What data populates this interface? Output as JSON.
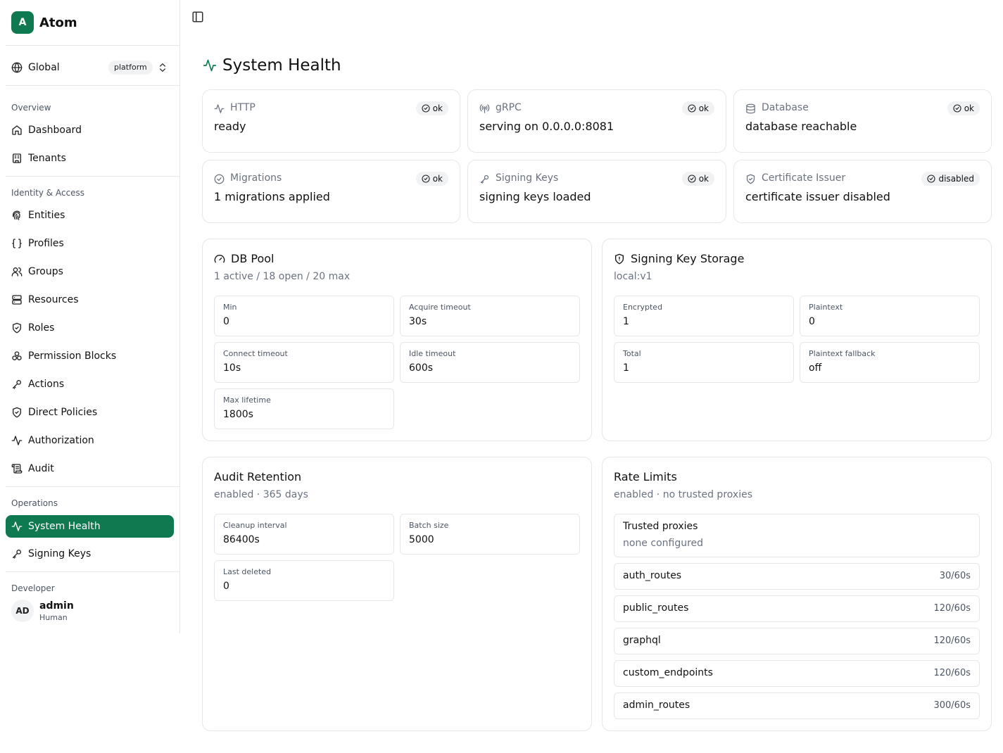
{
  "brand": {
    "logo_letter": "A",
    "name": "Atom"
  },
  "scope": {
    "label": "Global",
    "badge": "platform"
  },
  "sidebar": {
    "sections": [
      {
        "label": "Overview",
        "items": [
          {
            "label": "Dashboard",
            "icon": "home-icon"
          },
          {
            "label": "Tenants",
            "icon": "building-icon"
          }
        ]
      },
      {
        "label": "Identity & Access",
        "items": [
          {
            "label": "Entities",
            "icon": "fingerprint-icon"
          },
          {
            "label": "Profiles",
            "icon": "braces-icon"
          },
          {
            "label": "Groups",
            "icon": "users-icon"
          },
          {
            "label": "Resources",
            "icon": "server-icon"
          },
          {
            "label": "Roles",
            "icon": "shield-check-icon"
          },
          {
            "label": "Permission Blocks",
            "icon": "blocks-icon"
          },
          {
            "label": "Actions",
            "icon": "key-icon"
          },
          {
            "label": "Direct Policies",
            "icon": "shield-check-icon"
          },
          {
            "label": "Authorization",
            "icon": "activity-icon"
          },
          {
            "label": "Audit",
            "icon": "scroll-icon"
          }
        ]
      },
      {
        "label": "Operations",
        "items": [
          {
            "label": "System Health",
            "icon": "activity-icon",
            "active": true
          },
          {
            "label": "Signing Keys",
            "icon": "key-icon"
          }
        ]
      },
      {
        "label": "Developer",
        "items": []
      }
    ]
  },
  "user": {
    "initials": "AD",
    "name": "admin",
    "type": "Human"
  },
  "page": {
    "title": "System Health"
  },
  "status_cards": [
    {
      "title": "HTTP",
      "value": "ready",
      "badge": "ok",
      "icon": "activity-icon"
    },
    {
      "title": "gRPC",
      "value": "serving on 0.0.0.0:8081",
      "badge": "ok",
      "icon": "radio-icon"
    },
    {
      "title": "Database",
      "value": "database reachable",
      "badge": "ok",
      "icon": "database-icon"
    },
    {
      "title": "Migrations",
      "value": "1 migrations applied",
      "badge": "ok",
      "icon": "check-circle-icon"
    },
    {
      "title": "Signing Keys",
      "value": "signing keys loaded",
      "badge": "ok",
      "icon": "key-icon"
    },
    {
      "title": "Certificate Issuer",
      "value": "certificate issuer disabled",
      "badge": "disabled",
      "icon": "shield-check-icon"
    }
  ],
  "db_pool": {
    "title": "DB Pool",
    "subtitle": "1 active / 18 open / 20 max",
    "stats": [
      {
        "label": "Min",
        "value": "0"
      },
      {
        "label": "Acquire timeout",
        "value": "30s"
      },
      {
        "label": "Connect timeout",
        "value": "10s"
      },
      {
        "label": "Idle timeout",
        "value": "600s"
      },
      {
        "label": "Max lifetime",
        "value": "1800s"
      }
    ]
  },
  "key_storage": {
    "title": "Signing Key Storage",
    "subtitle": "local:v1",
    "stats": [
      {
        "label": "Encrypted",
        "value": "1"
      },
      {
        "label": "Plaintext",
        "value": "0"
      },
      {
        "label": "Total",
        "value": "1"
      },
      {
        "label": "Plaintext fallback",
        "value": "off"
      }
    ]
  },
  "audit_retention": {
    "title": "Audit Retention",
    "subtitle": "enabled · 365 days",
    "stats": [
      {
        "label": "Cleanup interval",
        "value": "86400s"
      },
      {
        "label": "Batch size",
        "value": "5000"
      },
      {
        "label": "Last deleted",
        "value": "0"
      }
    ]
  },
  "rate_limits": {
    "title": "Rate Limits",
    "subtitle": "enabled · no trusted proxies",
    "trusted_proxies": {
      "label": "Trusted proxies",
      "value": "none configured"
    },
    "rows": [
      {
        "name": "auth_routes",
        "limit": "30/60s"
      },
      {
        "name": "public_routes",
        "limit": "120/60s"
      },
      {
        "name": "graphql",
        "limit": "120/60s"
      },
      {
        "name": "custom_endpoints",
        "limit": "120/60s"
      },
      {
        "name": "admin_routes",
        "limit": "300/60s"
      }
    ]
  },
  "colors": {
    "accent": "#0f7a50",
    "border": "#e5e7eb",
    "muted": "#6b7280"
  }
}
